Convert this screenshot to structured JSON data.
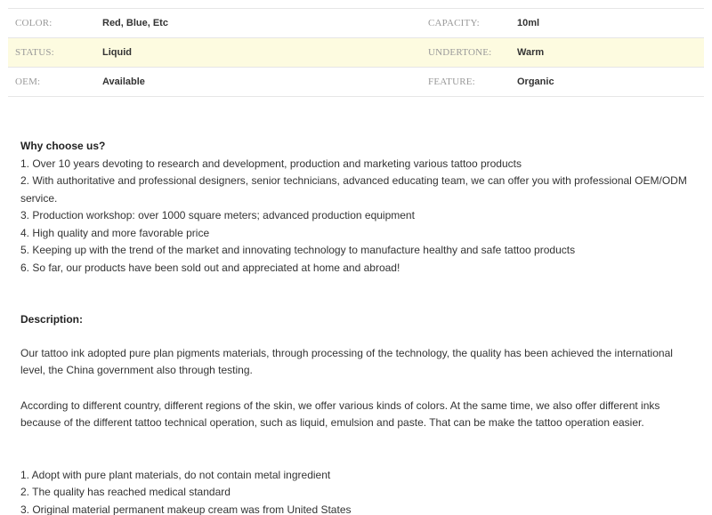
{
  "specs": [
    {
      "label1": "COLOR:",
      "value1": "Red, Blue, Etc",
      "label2": "CAPACITY:",
      "value2": "10ml"
    },
    {
      "label1": "STATUS:",
      "value1": "Liquid",
      "label2": "UNDERTONE:",
      "value2": "Warm"
    },
    {
      "label1": "OEM:",
      "value1": "Available",
      "label2": "FEATURE:",
      "value2": "Organic"
    }
  ],
  "why": {
    "heading": "Why choose us?",
    "items": [
      "1. Over 10 years devoting to research and development, production and marketing various tattoo products",
      "2. With authoritative and professional designers, senior technicians, advanced educating team, we can offer you with professional OEM/ODM service.",
      "3. Production workshop: over 1000 square meters; advanced production equipment",
      "4. High quality and more favorable price",
      "5. Keeping up with the trend of the market and innovating technology to manufacture healthy and safe tattoo products",
      "6. So far, our products have been sold out and appreciated at home and abroad!"
    ]
  },
  "description": {
    "heading": "Description:",
    "para1": "Our tattoo ink adopted pure plan pigments materials, through processing of the technology, the quality has been achieved the international level, the China government also through testing.",
    "para2": "According to different country, different regions of the skin, we offer various kinds of colors. At the same time, we also offer different inks because of the different tattoo technical operation, such as liquid, emulsion and paste. That can be make the tattoo operation easier.",
    "items": [
      "1. Adopt with pure plant materials, do not contain metal ingredient",
      "2. The quality has reached medical standard",
      "3. Original material permanent makeup cream was from United States"
    ]
  }
}
